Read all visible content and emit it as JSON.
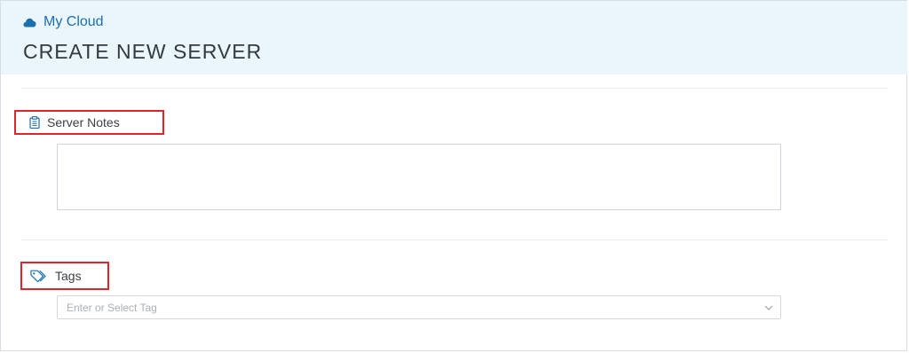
{
  "header": {
    "breadcrumb_label": "My Cloud",
    "title": "CREATE NEW SERVER"
  },
  "server_notes": {
    "label": "Server Notes",
    "value": ""
  },
  "tags": {
    "label": "Tags",
    "placeholder": "Enter or Select Tag",
    "value": ""
  },
  "colors": {
    "accent": "#1a6fb0",
    "header_bg": "#eaf6fc",
    "highlight": "#e0242c"
  },
  "icons": {
    "breadcrumb": "cloud-icon",
    "server_notes": "clipboard-icon",
    "tags": "tag-icon",
    "tags_dropdown": "chevron-down-icon"
  }
}
